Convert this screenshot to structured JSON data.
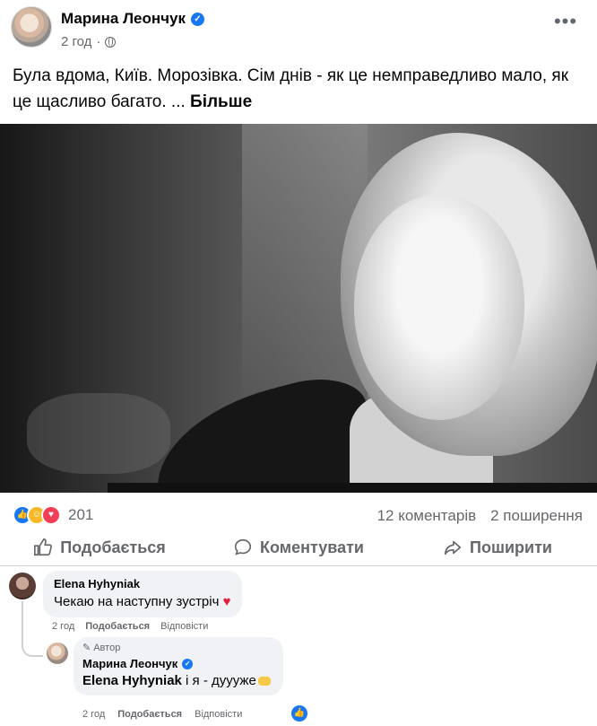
{
  "post": {
    "author": "Марина Леончук",
    "time": "2 год",
    "text": "Була вдома, Київ. Морозівка. Сім днів - як це немправедливо мало, як це щасливо багато. ...",
    "see_more": "Більше",
    "more_icon": "•••"
  },
  "stats": {
    "reaction_count": "201",
    "comments": "12 коментарів",
    "shares": "2 поширення"
  },
  "actions": {
    "like": "Подобається",
    "comment": "Коментувати",
    "share": "Поширити"
  },
  "comment": {
    "name": "Elena Hyhyniak",
    "text": "Чекаю на наступну зустріч",
    "heart": "♥",
    "time": "2 год",
    "like": "Подобається",
    "reply": "Відповісти"
  },
  "reply": {
    "badge": "Автор",
    "name": "Марина Леончук",
    "mention": "Elena Hyhyniak",
    "text": " і я - дуууже",
    "time": "2 год",
    "like": "Подобається",
    "reply": "Відповісти"
  },
  "colors": {
    "facebook_blue": "#1877f2",
    "secondary_text": "#65676b",
    "love_red": "#f33e58"
  },
  "icons": [
    "verified-icon",
    "globe-icon",
    "more-icon",
    "like-icon",
    "comment-icon",
    "share-icon",
    "heart-icon"
  ]
}
